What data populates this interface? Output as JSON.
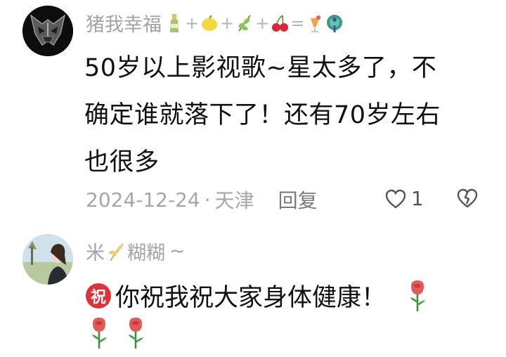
{
  "comments": [
    {
      "username": "猪我幸福",
      "username_emojis": [
        {
          "icon": "champagne-bottle-icon"
        },
        {
          "sep": "+"
        },
        {
          "icon": "lemon-icon"
        },
        {
          "sep": "+"
        },
        {
          "icon": "herb-icon"
        },
        {
          "sep": "+"
        },
        {
          "icon": "cherries-icon"
        },
        {
          "sep": "="
        },
        {
          "icon": "tropical-drink-icon"
        },
        {
          "icon": "peacock-icon"
        }
      ],
      "lines": [
        "50岁以上影视歌~星太多了，不",
        "确定谁就落下了！还有70岁左右",
        "也很多"
      ],
      "date": "2024-12-24",
      "dot": "·",
      "location": "天津",
      "reply_label": "回复",
      "like_count": "1"
    },
    {
      "username_part1": "米",
      "username_part2": "糊糊",
      "username_tilde": "~",
      "badge_text": "祝",
      "text": "你祝我祝大家身体健康！",
      "rose_icon": "rose-icon"
    }
  ],
  "colors": {
    "name_gray": "#a3a3a3",
    "meta_gray": "#a6a6a6",
    "badge_red": "#d9343a",
    "rose_red": "#e05a5a",
    "stem_green": "#3a8a3a"
  }
}
